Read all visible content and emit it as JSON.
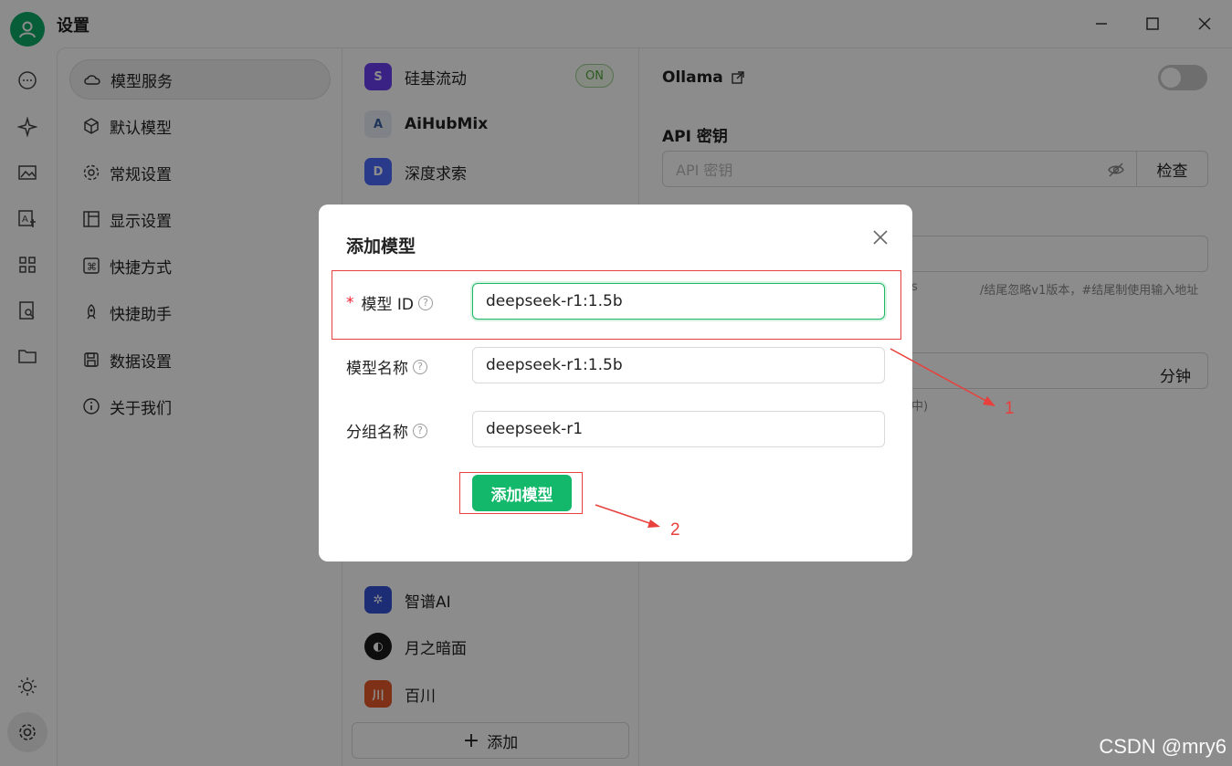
{
  "app": {
    "title": "设置"
  },
  "menu": {
    "items": [
      {
        "label": "模型服务",
        "icon": "cloud-icon",
        "active": true
      },
      {
        "label": "默认模型",
        "icon": "cube-icon"
      },
      {
        "label": "常规设置",
        "icon": "gear-icon"
      },
      {
        "label": "显示设置",
        "icon": "layout-icon"
      },
      {
        "label": "快捷方式",
        "icon": "command-icon"
      },
      {
        "label": "快捷助手",
        "icon": "rocket-icon"
      },
      {
        "label": "数据设置",
        "icon": "save-icon"
      },
      {
        "label": "关于我们",
        "icon": "info-icon"
      }
    ]
  },
  "providers": {
    "items": [
      {
        "label": "硅基流动",
        "badge": "ON",
        "color": "#6b3ff0"
      },
      {
        "label": "AiHubMix",
        "color": "#e8eef6"
      },
      {
        "label": "深度求索",
        "color": "#4d6bfe"
      },
      {
        "label": "智谱AI",
        "color": "#3453d8"
      },
      {
        "label": "月之暗面",
        "color": "#1a1a1a"
      },
      {
        "label": "百川",
        "color": "#e65a2a"
      }
    ],
    "add_label": "添加"
  },
  "detail": {
    "provider_name": "Ollama",
    "api_key_title": "API 密钥",
    "api_key_placeholder": "API 密钥",
    "check_label": "检查",
    "hint_left": "s",
    "hint_right": "/结尾忽略v1版本，#结尾制使用输入地址",
    "minutes_label": "分钟",
    "minutes_hint": "中)"
  },
  "modal": {
    "title": "添加模型",
    "model_id_label": "模型 ID",
    "model_id_value": "deepseek-r1:1.5b",
    "model_name_label": "模型名称",
    "model_name_value": "deepseek-r1:1.5b",
    "group_label": "分组名称",
    "group_value": "deepseek-r1",
    "submit_label": "添加模型",
    "required_mark": "*",
    "help_glyph": "?"
  },
  "annotations": {
    "one": "1",
    "two": "2"
  },
  "watermark": "CSDN @mry6",
  "colors": {
    "accent": "#13b86a",
    "annotation": "#e8403c"
  }
}
